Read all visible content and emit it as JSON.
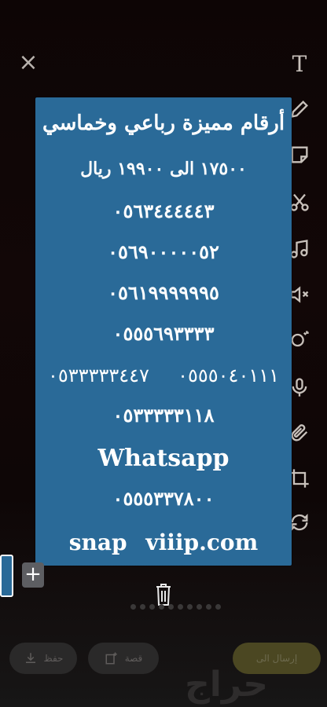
{
  "toolbar": {
    "close_icon": "×",
    "text_tool_glyph": "T",
    "icons": [
      "text-icon",
      "pencil-icon",
      "sticker-icon",
      "scissors-icon",
      "music-icon",
      "mute-icon",
      "magic-icon",
      "microphone-icon",
      "attach-icon",
      "crop-icon",
      "loop-icon"
    ]
  },
  "card": {
    "background": "#2a6a98",
    "title": "أرقام مميزة رباعي وخماسي",
    "price": "١٧٥٠٠ الى ١٩٩٠٠ ريال",
    "numbers": [
      "٠٥٦٣٤٤٤٤٤٣",
      "٠٥٦٩٠٠٠٠٠٥٢",
      "٠٥٦١٩٩٩٩٩٩٥",
      "٠٥٥٥٦٩٣٣٣٣"
    ],
    "split_left": "٠٥٣٣٣٣٣٤٤٧",
    "split_right": "٠٥٥٥٠٤٠١١١",
    "number_6": "٠٥٣٣٣٣٣١١٨",
    "whatsapp_label": "Whatsapp",
    "whatsapp_number": "٠٥٥٥٣٣٧٨٠٠",
    "snap_line": "snap viiip.com"
  },
  "bottom": {
    "add_label": "+",
    "save_label": "حفظ",
    "story_label": "قصة",
    "send_label": "إرسال الى",
    "brand": "حراج"
  }
}
